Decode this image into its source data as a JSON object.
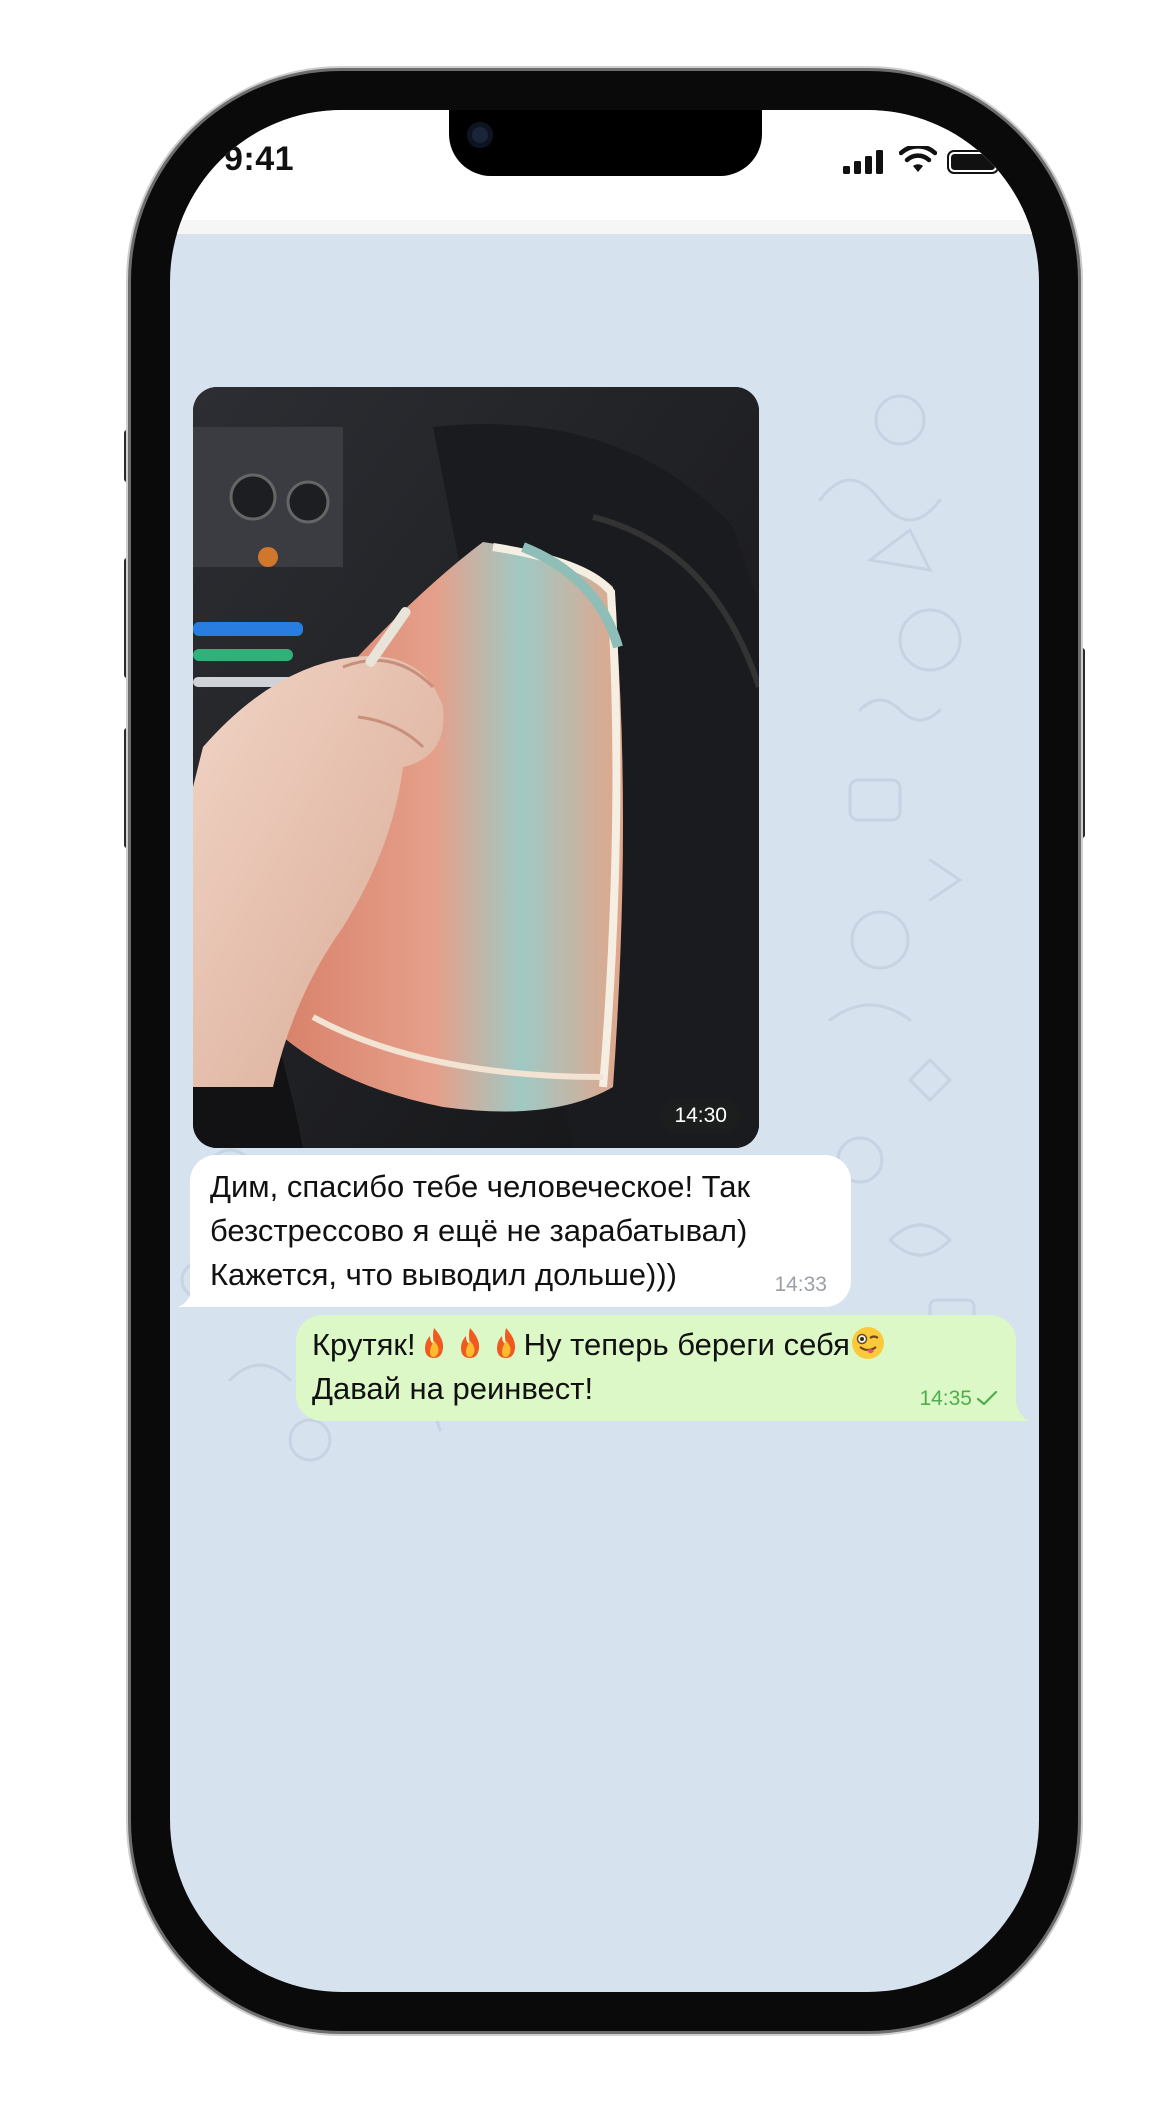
{
  "status_bar": {
    "time": "9:41",
    "icons": [
      "cellular-signal-icon",
      "wifi-icon",
      "battery-icon"
    ]
  },
  "chat": {
    "background_color": "#d7e2ef",
    "messages": [
      {
        "type": "photo",
        "direction": "incoming",
        "time": "14:30",
        "image_subject": "hand holding a thick stack of 5000 ruble banknotes in a car"
      },
      {
        "type": "text",
        "direction": "incoming",
        "lines": [
          "Дим, спасибо тебе человеческое! Так",
          "безстрессово я ещё не зарабатывал)",
          "Кажется, что выводил дольше)))"
        ],
        "time": "14:33"
      },
      {
        "type": "text",
        "direction": "outgoing",
        "line1_prefix": "Крутяк!",
        "line1_suffix": "Ну теперь береги себя",
        "line2": "Давай на реинвест!",
        "emojis": [
          "fire-emoji",
          "fire-emoji",
          "fire-emoji",
          "winking-face-with-tongue-emoji"
        ],
        "time": "14:35",
        "status": "sent-check-icon"
      }
    ]
  },
  "colors": {
    "incoming_bubble": "#ffffff",
    "outgoing_bubble": "#dcf8c6",
    "outgoing_time": "#4fae4e",
    "incoming_time": "#9aa0a6"
  }
}
